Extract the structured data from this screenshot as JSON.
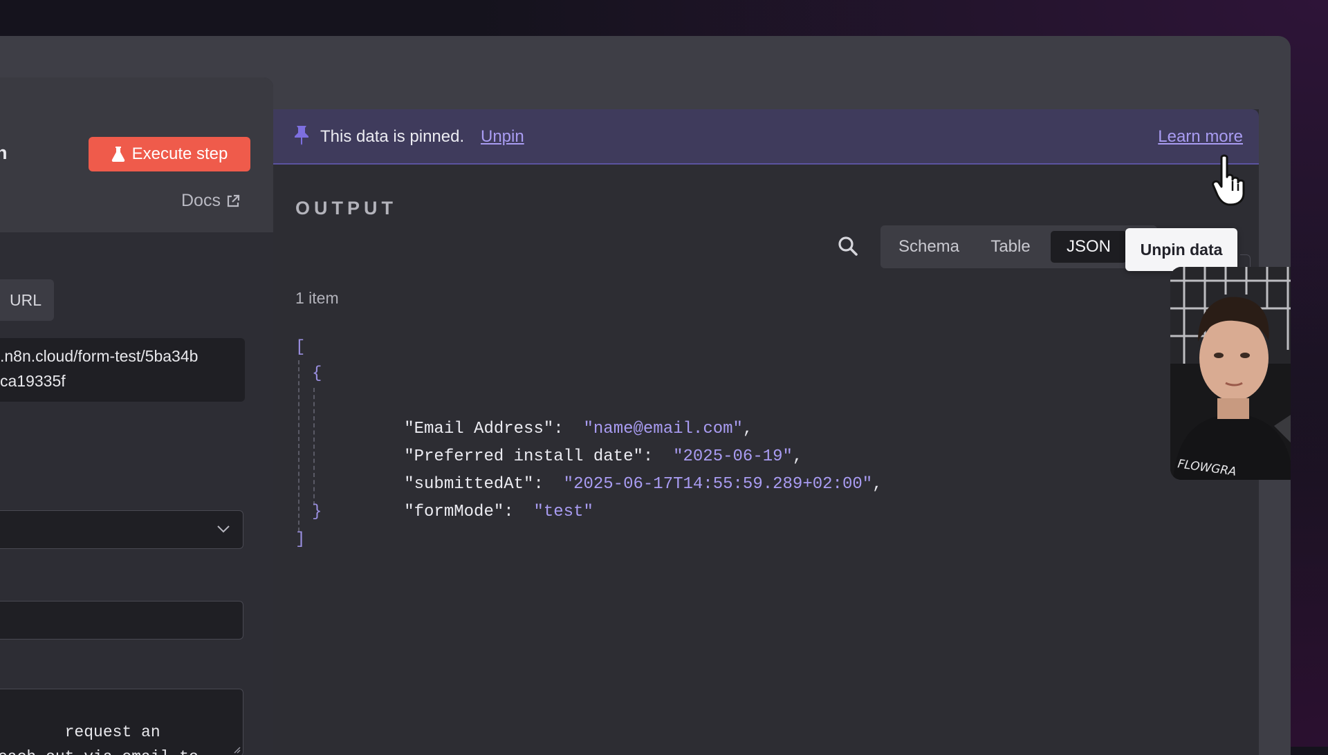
{
  "left_panel": {
    "title_fragment": "n",
    "execute_button": "Execute step",
    "docs_link": "Docs",
    "url_tab": "URL",
    "url_value": ".n8n.cloud/form-test/5ba34b\nca19335f",
    "textarea_value": " request an\neach out via email to"
  },
  "banner": {
    "message": "This data is pinned.",
    "unpin_link": "Unpin",
    "learn_more_link": "Learn more"
  },
  "output": {
    "title": "OUTPUT",
    "item_count": "1 item",
    "views": [
      "Schema",
      "Table",
      "JSON"
    ],
    "active_view": "JSON",
    "tooltip": "Unpin data",
    "json_open": "[",
    "json_close": "]",
    "obj_open": "{",
    "obj_close": "}",
    "fields": [
      {
        "key": "\"Email Address\"",
        "value": "\"name@email.com\""
      },
      {
        "key": "\"Preferred install date\"",
        "value": "\"2025-06-19\""
      },
      {
        "key": "\"submittedAt\"",
        "value": "\"2025-06-17T14:55:59.289+02:00\""
      },
      {
        "key": "\"formMode\"",
        "value": "\"test\""
      }
    ]
  },
  "webcam": {
    "shirt_text": "FLOWGRA"
  },
  "colors": {
    "accent_red": "#ef5b4b",
    "banner_bg": "#3f3b5c",
    "link_purple": "#a99cf2"
  },
  "icons": {
    "execute": "flask-icon",
    "docs": "external-link-icon",
    "banner": "pin-icon",
    "search": "search-icon",
    "select": "chevron-down-icon",
    "pointer": "hand-pointer-cursor-icon"
  }
}
